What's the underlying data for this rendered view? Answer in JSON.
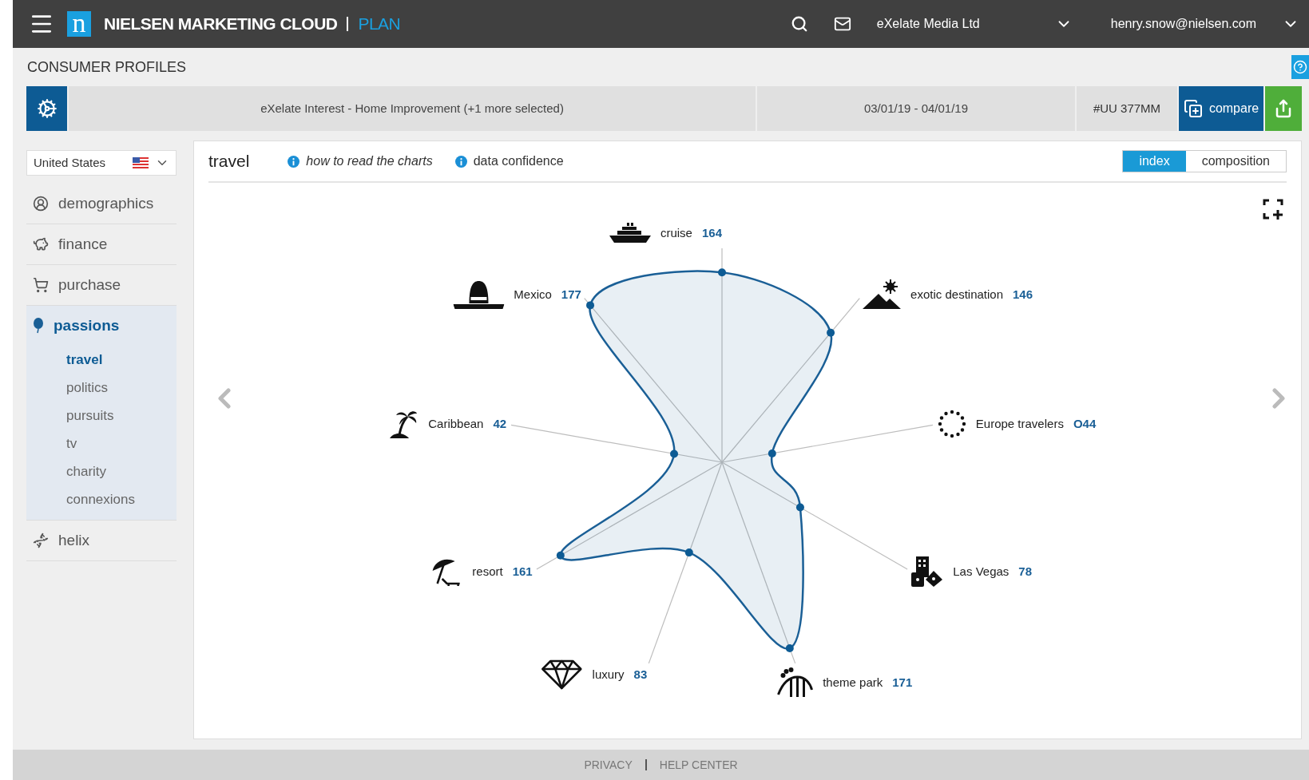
{
  "topbar": {
    "logo_letter": "n",
    "brand": "NIELSEN MARKETING CLOUD",
    "product": "PLAN",
    "account": "eXelate Media Ltd",
    "user": "henry.snow@nielsen.com"
  },
  "page_title": "CONSUMER PROFILES",
  "filter_bar": {
    "segment": "eXelate Interest - Home Improvement (+1 more selected)",
    "date_range": "03/01/19 - 04/01/19",
    "audience": "#UU 377MM",
    "compare_label": "compare"
  },
  "sidebar": {
    "country": "United States",
    "items": [
      {
        "label": "demographics",
        "selected": false
      },
      {
        "label": "finance",
        "selected": false
      },
      {
        "label": "purchase",
        "selected": false
      },
      {
        "label": "passions",
        "selected": true,
        "children": [
          {
            "label": "travel",
            "selected": true
          },
          {
            "label": "politics",
            "selected": false
          },
          {
            "label": "pursuits",
            "selected": false
          },
          {
            "label": "tv",
            "selected": false
          },
          {
            "label": "charity",
            "selected": false
          },
          {
            "label": "connexions",
            "selected": false
          }
        ]
      },
      {
        "label": "helix",
        "selected": false
      }
    ]
  },
  "panel": {
    "title": "travel",
    "links": [
      "how to read the charts",
      "data confidence"
    ],
    "tabs": [
      {
        "label": "index",
        "selected": true
      },
      {
        "label": "composition",
        "selected": false
      }
    ],
    "axes": [
      {
        "label": "cruise",
        "value": "164"
      },
      {
        "label": "Mexico",
        "value": "177"
      },
      {
        "label": "exotic destination",
        "value": "146"
      },
      {
        "label": "Caribbean",
        "value": "42"
      },
      {
        "label": "Europe travelers",
        "value": "O44"
      },
      {
        "label": "resort",
        "value": "161"
      },
      {
        "label": "Las Vegas",
        "value": "78"
      },
      {
        "label": "luxury",
        "value": "83"
      },
      {
        "label": "theme park",
        "value": "171"
      }
    ]
  },
  "footer": {
    "links": [
      "PRIVACY",
      "HELP CENTER"
    ]
  }
}
